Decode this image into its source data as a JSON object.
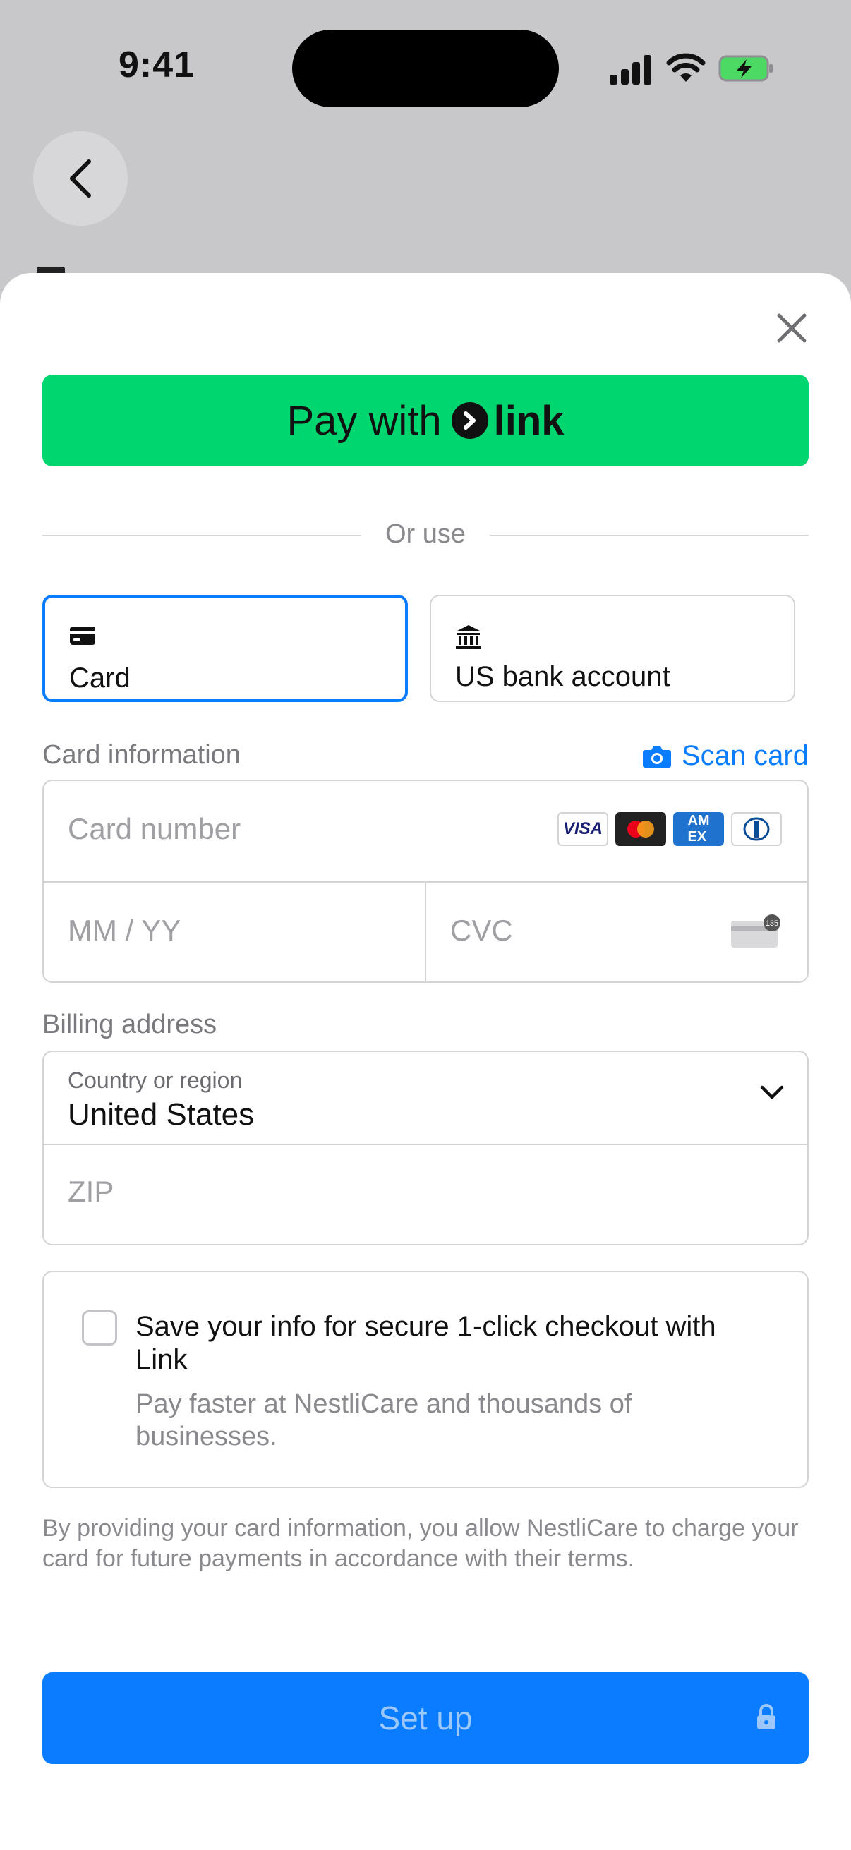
{
  "status_bar": {
    "time": "9:41"
  },
  "sheet": {
    "link_button": {
      "prefix": "Pay with",
      "brand": "link"
    },
    "divider_text": "Or use",
    "tabs": [
      {
        "label": "Card",
        "icon": "card-icon",
        "selected": true
      },
      {
        "label": "US bank account",
        "icon": "bank-icon",
        "selected": false
      }
    ],
    "card_section": {
      "label": "Card information",
      "scan_label": "Scan card",
      "number_placeholder": "Card number",
      "expiry_placeholder": "MM / YY",
      "cvc_placeholder": "CVC",
      "cvc_badge": "135",
      "brands": [
        "VISA",
        "Mastercard",
        "American Express",
        "Diners Club"
      ]
    },
    "billing_section": {
      "label": "Billing address",
      "country_label": "Country or region",
      "country_value": "United States",
      "zip_placeholder": "ZIP"
    },
    "save_info": {
      "title": "Save your info for secure 1-click checkout with Link",
      "subtitle": "Pay faster at NestliCare and thousands of businesses.",
      "checked": false
    },
    "legal_text": "By providing your card information, you allow NestliCare to charge your card for future payments in accordance with their terms.",
    "submit_label": "Set up"
  },
  "colors": {
    "link_green": "#00d66f",
    "accent_blue": "#0a7cff",
    "backdrop": "#c8c8cb"
  }
}
